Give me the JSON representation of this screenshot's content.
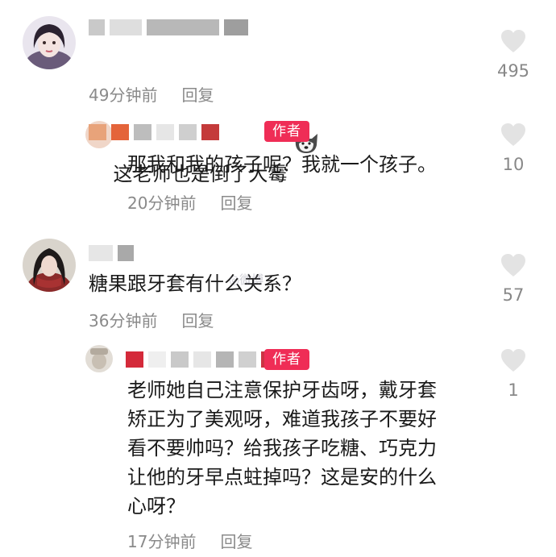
{
  "comments": [
    {
      "text": "这老师也是倒了大霉",
      "time": "49分钟前",
      "reply_label": "回复",
      "likes": "495",
      "emoji": "dog-icon",
      "name_colors": [
        "#c9c9c9",
        "#dedede",
        "#b8b8b8",
        "#9e9e9e"
      ]
    },
    {
      "is_author_reply": true,
      "badge": "作者",
      "text": "那我和我的孩子呢？我就一个孩子。",
      "time": "20分钟前",
      "reply_label": "回复",
      "likes": "10",
      "name_colors": [
        "#e8a37a",
        "#e4643a",
        "#bdbdbd",
        "#cfcfcf",
        "#c43a3a"
      ]
    },
    {
      "text": "糖果跟牙套有什么关系？",
      "time": "36分钟前",
      "reply_label": "回复",
      "likes": "57",
      "name_colors": [
        "#d8d8d8",
        "#a9a9a9"
      ]
    },
    {
      "is_author_reply": true,
      "badge": "作者",
      "text": "老师她自己注意保护牙齿呀，戴牙套\n矫正为了美观呀，难道我孩子不要好\n看不要帅吗？给我孩子吃糖、巧克力\n让他的牙早点蛀掉吗？这是安的什么\n心呀？",
      "time": "17分钟前",
      "reply_label": "回复",
      "likes": "1",
      "name_colors": [
        "#d42a3a",
        "#c9c9c9",
        "#b5b5b5",
        "#d0d0d0",
        "#cc3344"
      ]
    }
  ],
  "colors": {
    "author_badge": "#ef2d56",
    "meta_text": "#8a8a8a",
    "heart": "#e3e3e3"
  }
}
